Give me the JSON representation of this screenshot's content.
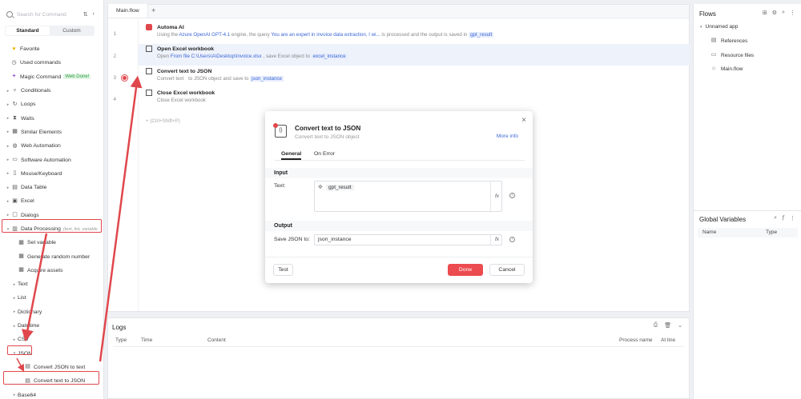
{
  "colors": {
    "accent": "#ec4b4f",
    "link": "#3b66d6",
    "highlight": "#e0474c"
  },
  "left_panel": {
    "search_placeholder": "Search for Command",
    "tabs": [
      "Standard",
      "Custom"
    ],
    "items": [
      {
        "label": "Favorite",
        "icon": "heart-icon"
      },
      {
        "label": "Used commands",
        "icon": "clock-icon"
      },
      {
        "label": "Magic Command",
        "icon": "magic-icon",
        "tag": "Web Done!"
      },
      {
        "label": "Conditionals",
        "icon": "branch-icon"
      },
      {
        "label": "Loops",
        "icon": "loop-icon"
      },
      {
        "label": "Waits",
        "icon": "hourglass-icon"
      },
      {
        "label": "Similar Elements",
        "icon": "grid-icon"
      },
      {
        "label": "Web Automation",
        "icon": "globe-icon"
      },
      {
        "label": "Software Automation",
        "icon": "monitor-icon"
      },
      {
        "label": "Mouse/Keyboard",
        "icon": "mouse-icon"
      },
      {
        "label": "Data Table",
        "icon": "table-icon"
      },
      {
        "label": "Excel",
        "icon": "excel-icon"
      },
      {
        "label": "Dialogs",
        "icon": "dialog-icon"
      },
      {
        "label": "Data Processing",
        "icon": "data-icon",
        "hint": "(text, list, variable"
      },
      {
        "label": "Set variable",
        "icon": "variable-icon"
      },
      {
        "label": "Generate random number",
        "icon": "variable-icon"
      },
      {
        "label": "Acquire assets",
        "icon": "variable-icon"
      },
      {
        "label": "Text"
      },
      {
        "label": "List"
      },
      {
        "label": "Dictionary"
      },
      {
        "label": "Datetime"
      },
      {
        "label": "CSV"
      },
      {
        "label": "JSON"
      },
      {
        "label": "Convert JSON to text",
        "icon": "convert-icon"
      },
      {
        "label": "Convert text to JSON",
        "icon": "convert-icon"
      },
      {
        "label": "Base64"
      }
    ]
  },
  "editor": {
    "tab": "Main.flow",
    "add_hint": "(Ctrl+Shift+P)",
    "steps": [
      {
        "num": "1",
        "title": "Automa AI",
        "desc": [
          "Using the ",
          "Azure OpenAI",
          " engine, the query ",
          "You are an expert in invoice data extraction. I wi...",
          " is processed and the output is saved in "
        ],
        "model": "GPT-4.1",
        "var": "gpt_result"
      },
      {
        "num": "2",
        "title": "Open Excel workbook",
        "desc": [
          "Open ",
          "From file",
          " ",
          "C:\\Users\\A\\Desktop\\Invoice.xlsx",
          " , save Excel object to "
        ],
        "var": "excel_instance"
      },
      {
        "num": "3",
        "title": "Convert text to JSON",
        "desc": [
          "Convert text ",
          "",
          " to JSON object and save to "
        ],
        "var": "json_instance"
      },
      {
        "num": "4",
        "title": "Close Excel workbook",
        "desc": [
          "Close Excel workbook"
        ]
      }
    ]
  },
  "logs": {
    "title": "Logs",
    "columns": [
      "Type",
      "Time",
      "Content",
      "Process name",
      "At line"
    ]
  },
  "right_panel": {
    "flows_title": "Flows",
    "app_name": "Unnamed app",
    "items": [
      "References",
      "Resource files",
      "Main.flow"
    ],
    "globals_title": "Global Variables",
    "globals_columns": [
      "Name",
      "Type"
    ]
  },
  "dialog": {
    "title": "Convert text to JSON",
    "subtitle": "Convert text to JSON object",
    "more_info": "More info",
    "tabs": [
      "General",
      "On Error"
    ],
    "input_section": "Input",
    "text_label": "Text:",
    "text_value": "gpt_result",
    "output_section": "Output",
    "save_label": "Save JSON to:",
    "save_value": "json_instance",
    "test_label": "Test",
    "done_label": "Done",
    "cancel_label": "Cancel",
    "fx": "fx"
  }
}
